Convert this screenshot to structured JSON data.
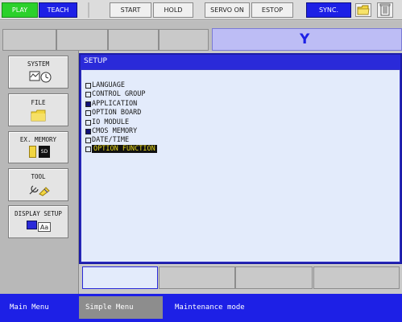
{
  "topbar": {
    "play": "PLAY",
    "teach": "TEACH",
    "start": "START",
    "hold": "HOLD",
    "servo_on": "SERVO ON",
    "estop": "ESTOP",
    "sync": "SYNC."
  },
  "axis_indicator": "Y",
  "left_menu": {
    "system": "SYSTEM",
    "file": "FILE",
    "ex_memory": "EX. MEMORY",
    "sd_badge": "SD",
    "tool": "TOOL",
    "display_setup": "DISPLAY SETUP",
    "aa_badge": "Aa"
  },
  "main": {
    "title": "SETUP",
    "items": [
      {
        "label": "LANGUAGE",
        "checked": false
      },
      {
        "label": "CONTROL GROUP",
        "checked": false
      },
      {
        "label": "APPLICATION",
        "checked": true
      },
      {
        "label": "OPTION BOARD",
        "checked": false
      },
      {
        "label": "IO MODULE",
        "checked": false
      },
      {
        "label": "CMOS MEMORY",
        "checked": true
      },
      {
        "label": "DATE/TIME",
        "checked": false
      },
      {
        "label": "OPTION FUNCTION",
        "checked": false,
        "selected": true
      }
    ]
  },
  "bottombar": {
    "main_menu": "Main Menu",
    "simple_menu": "Simple Menu",
    "mode": "Maintenance mode"
  },
  "colors": {
    "play": "#2bd12b",
    "teach": "#1d20e6",
    "sync": "#1d20e6",
    "panel_blue": "#2a2ad9",
    "panel_bg": "#e3ebfb",
    "selection_text": "#e8d81a"
  }
}
